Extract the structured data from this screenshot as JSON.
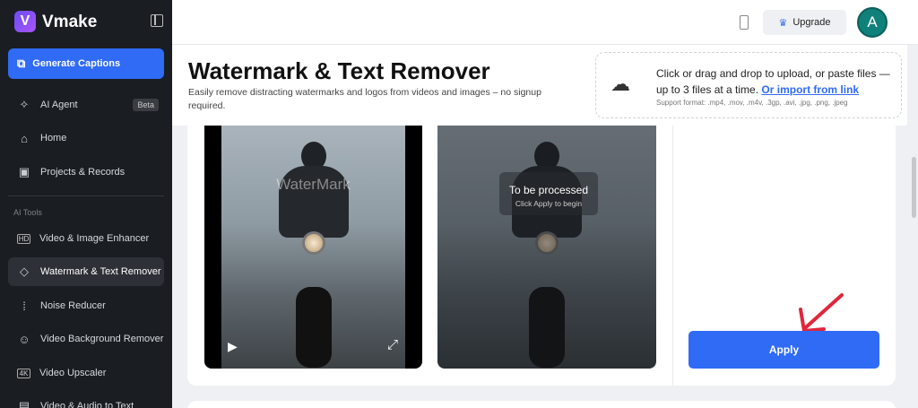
{
  "app": {
    "name": "Vmake",
    "logo_letter": "V"
  },
  "sidebar": {
    "primary_button": "Generate Captions",
    "items": [
      {
        "label": "AI Agent",
        "badge": "Beta",
        "icon": "sparkle-icon"
      },
      {
        "label": "Home",
        "icon": "home-icon"
      },
      {
        "label": "Projects & Records",
        "icon": "folder-icon"
      }
    ],
    "section_title": "AI Tools",
    "tools": [
      {
        "label": "Video & Image Enhancer",
        "icon": "hd-icon"
      },
      {
        "label": "Watermark & Text Remover",
        "icon": "eraser-icon",
        "active": true
      },
      {
        "label": "Noise Reducer",
        "icon": "noise-icon"
      },
      {
        "label": "Video Background Remover",
        "icon": "person-icon"
      },
      {
        "label": "Video Upscaler",
        "icon": "4k-icon"
      },
      {
        "label": "Video & Audio to Text",
        "icon": "text-icon"
      }
    ]
  },
  "topbar": {
    "upgrade_label": "Upgrade",
    "avatar_letter": "A"
  },
  "header": {
    "title": "Watermark & Text Remover",
    "description": "Easily remove distracting watermarks and logos from videos and images – no signup required."
  },
  "upload": {
    "text": "Click or drag and drop to upload, or paste files — up to 3 files at a time.",
    "link": "Or import from link",
    "formats": "Support format: .mp4, .mov, .m4v, .3gp, .avi, .jpg, .png, .jpeg"
  },
  "preview": {
    "watermark_text": "WaterMark",
    "processed_title": "To be processed",
    "processed_hint": "Click Apply to begin"
  },
  "apply_label": "Apply",
  "colors": {
    "accent": "#2f6bf5",
    "sidebar_bg": "#1a1d21",
    "avatar": "#10807a",
    "arrow": "#e0263c"
  }
}
